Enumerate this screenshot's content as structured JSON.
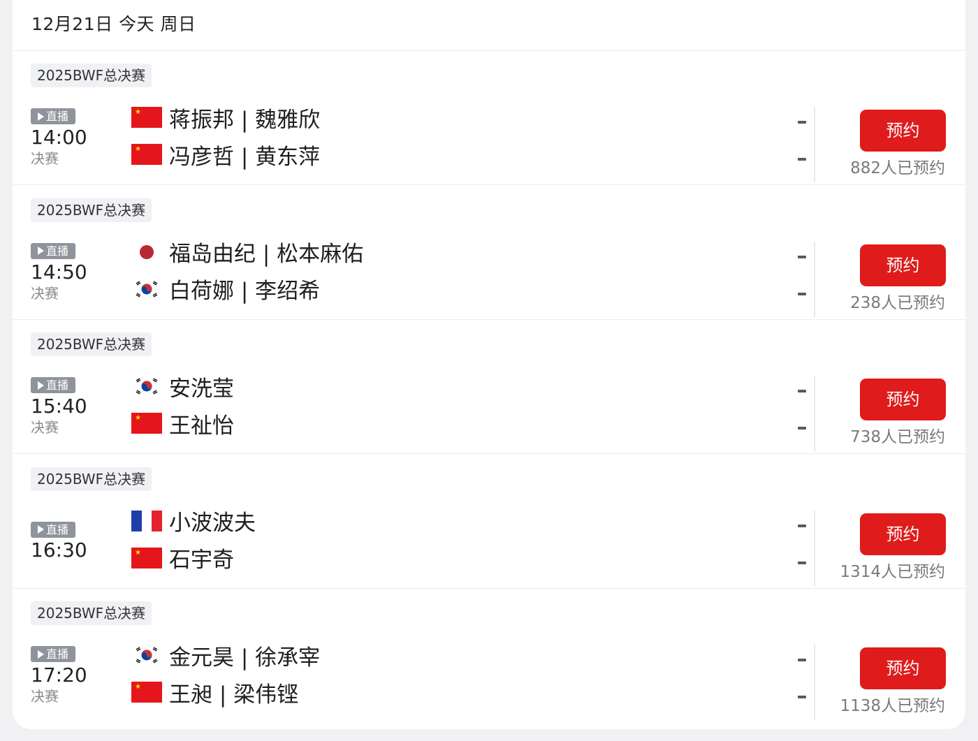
{
  "date_header": "12月21日 今天 周日",
  "colors": {
    "accent_red": "#df1b1b",
    "live_badge_gray": "#8f939b",
    "tag_bg": "#f0f1f4"
  },
  "matches": [
    {
      "tournament": "2025BWF总决赛",
      "live_label": "直播",
      "time": "14:00",
      "round": "决赛",
      "players": [
        {
          "flag": "china-flag-icon",
          "name": "蒋振邦 | 魏雅欣",
          "score": "-"
        },
        {
          "flag": "china-flag-icon",
          "name": "冯彦哲 | 黄东萍",
          "score": "-"
        }
      ],
      "button_label": "预约",
      "reserve_count": "882人已预约"
    },
    {
      "tournament": "2025BWF总决赛",
      "live_label": "直播",
      "time": "14:50",
      "round": "决赛",
      "players": [
        {
          "flag": "japan-flag-icon",
          "name": "福岛由纪 | 松本麻佑",
          "score": "-"
        },
        {
          "flag": "korea-flag-icon",
          "name": "白荷娜 | 李绍希",
          "score": "-"
        }
      ],
      "button_label": "预约",
      "reserve_count": "238人已预约"
    },
    {
      "tournament": "2025BWF总决赛",
      "live_label": "直播",
      "time": "15:40",
      "round": "决赛",
      "players": [
        {
          "flag": "korea-flag-icon",
          "name": "安洗莹",
          "score": "-"
        },
        {
          "flag": "china-flag-icon",
          "name": "王祉怡",
          "score": "-"
        }
      ],
      "button_label": "预约",
      "reserve_count": "738人已预约"
    },
    {
      "tournament": "2025BWF总决赛",
      "live_label": "直播",
      "time": "16:30",
      "round": "",
      "players": [
        {
          "flag": "france-flag-icon",
          "name": "小波波夫",
          "score": "-"
        },
        {
          "flag": "china-flag-icon",
          "name": "石宇奇",
          "score": "-"
        }
      ],
      "button_label": "预约",
      "reserve_count": "1314人已预约"
    },
    {
      "tournament": "2025BWF总决赛",
      "live_label": "直播",
      "time": "17:20",
      "round": "决赛",
      "players": [
        {
          "flag": "korea-flag-icon",
          "name": "金元昊 | 徐承宰",
          "score": "-"
        },
        {
          "flag": "china-flag-icon",
          "name": "王昶 | 梁伟铿",
          "score": "-"
        }
      ],
      "button_label": "预约",
      "reserve_count": "1138人已预约"
    }
  ]
}
